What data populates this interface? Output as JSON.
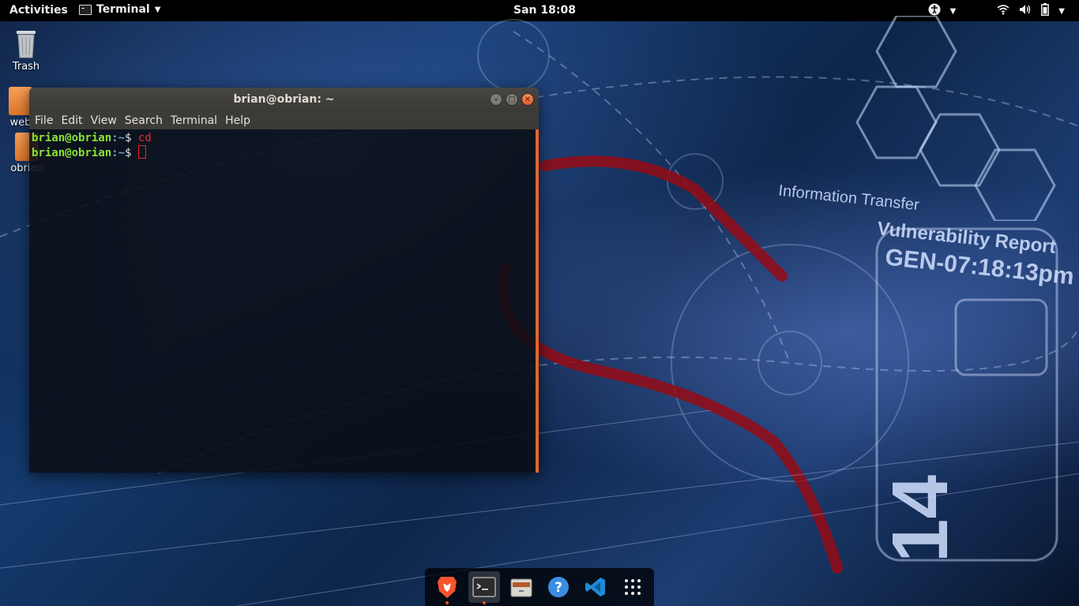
{
  "topbar": {
    "activities": "Activities",
    "app_name": "Terminal",
    "clock": "San 18:08"
  },
  "wallpaper": {
    "info_transfer": "Information Transfer",
    "vuln_report": "Vulnerability Report",
    "gen_code": "GEN-07:18:13pm",
    "big_number": "14"
  },
  "desktop_icons": [
    {
      "label": "Trash"
    },
    {
      "label": "web"
    },
    {
      "label": "obrian"
    }
  ],
  "terminal": {
    "title": "brian@obrian: ~",
    "menu": [
      "File",
      "Edit",
      "View",
      "Search",
      "Terminal",
      "Help"
    ],
    "lines": [
      {
        "user": "brian@obrian",
        "path": ":~",
        "sign": "$ ",
        "cmd": "cd"
      },
      {
        "user": "brian@obrian",
        "path": ":~",
        "sign": "$ ",
        "cmd": ""
      }
    ]
  },
  "dock": {
    "items": [
      "brave-browser",
      "terminal",
      "file-manager",
      "help",
      "vscode",
      "show-applications"
    ]
  },
  "colors": {
    "accent": "#e95420",
    "prompt_user": "#8ae234",
    "prompt_path": "#729fcf",
    "command": "#ef2929"
  }
}
